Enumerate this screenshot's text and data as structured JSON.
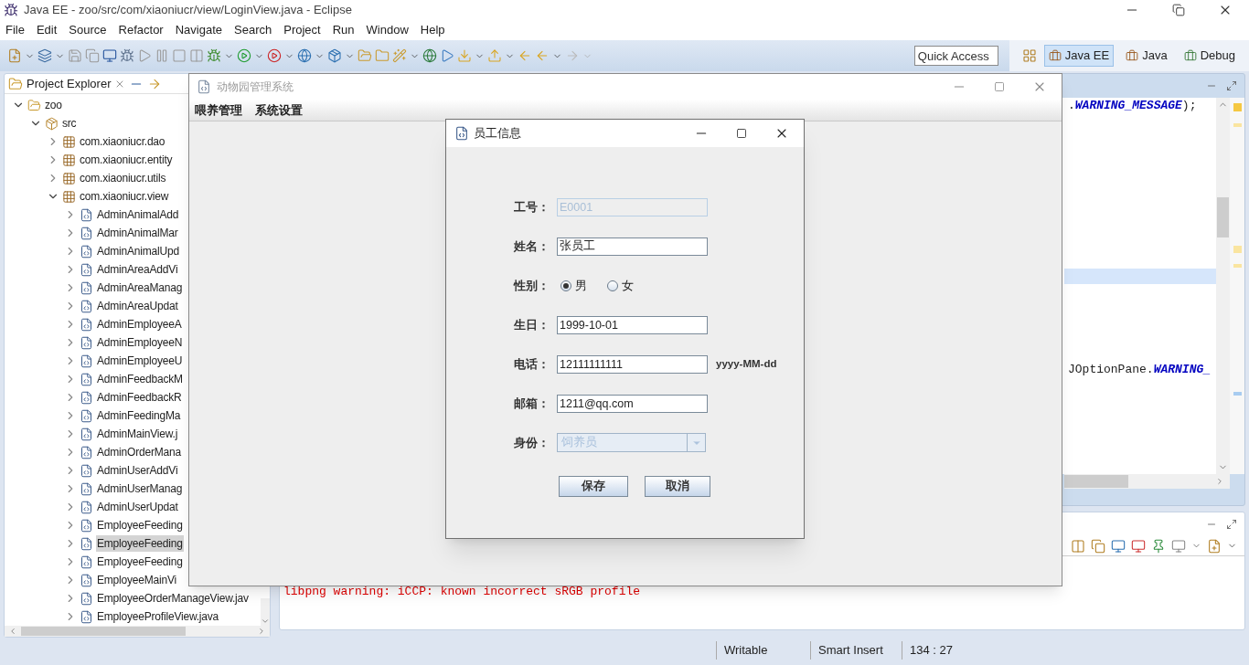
{
  "window": {
    "title": "Java EE - zoo/src/com/xiaoniucr/view/LoginView.java - Eclipse"
  },
  "menu": [
    "File",
    "Edit",
    "Source",
    "Refactor",
    "Navigate",
    "Search",
    "Project",
    "Run",
    "Window",
    "Help"
  ],
  "toolbar": {
    "quick_access": {
      "placeholder": "Quick Access"
    },
    "perspectives": [
      {
        "label": "Java EE",
        "selected": true
      },
      {
        "label": "Java",
        "selected": false
      },
      {
        "label": "Debug",
        "selected": false
      }
    ]
  },
  "project_explorer": {
    "title": "Project Explorer",
    "tree": [
      {
        "label": "zoo",
        "kind": "project",
        "expanded": true,
        "selected": false,
        "children": [
          {
            "label": "src",
            "kind": "folder",
            "expanded": true,
            "selected": false,
            "children": [
              {
                "label": "com.xiaoniucr.dao",
                "kind": "package",
                "expanded": false,
                "selected": false
              },
              {
                "label": "com.xiaoniucr.entity",
                "kind": "package",
                "expanded": false,
                "selected": false
              },
              {
                "label": "com.xiaoniucr.utils",
                "kind": "package",
                "expanded": false,
                "selected": false
              },
              {
                "label": "com.xiaoniucr.view",
                "kind": "package",
                "expanded": true,
                "selected": false,
                "children": [
                  {
                    "label": "AdminAnimalAdd",
                    "kind": "file",
                    "expanded": false,
                    "selected": false
                  },
                  {
                    "label": "AdminAnimalMar",
                    "kind": "file",
                    "expanded": false,
                    "selected": false
                  },
                  {
                    "label": "AdminAnimalUpd",
                    "kind": "file",
                    "expanded": false,
                    "selected": false
                  },
                  {
                    "label": "AdminAreaAddVi",
                    "kind": "file",
                    "expanded": false,
                    "selected": false
                  },
                  {
                    "label": "AdminAreaManag",
                    "kind": "file",
                    "expanded": false,
                    "selected": false
                  },
                  {
                    "label": "AdminAreaUpdat",
                    "kind": "file",
                    "expanded": false,
                    "selected": false
                  },
                  {
                    "label": "AdminEmployeeA",
                    "kind": "file",
                    "expanded": false,
                    "selected": false
                  },
                  {
                    "label": "AdminEmployeeN",
                    "kind": "file",
                    "expanded": false,
                    "selected": false
                  },
                  {
                    "label": "AdminEmployeeU",
                    "kind": "file",
                    "expanded": false,
                    "selected": false
                  },
                  {
                    "label": "AdminFeedbackM",
                    "kind": "file",
                    "expanded": false,
                    "selected": false
                  },
                  {
                    "label": "AdminFeedbackR",
                    "kind": "file",
                    "expanded": false,
                    "selected": false
                  },
                  {
                    "label": "AdminFeedingMa",
                    "kind": "file",
                    "expanded": false,
                    "selected": false
                  },
                  {
                    "label": "AdminMainView.j",
                    "kind": "file",
                    "expanded": false,
                    "selected": false
                  },
                  {
                    "label": "AdminOrderMana",
                    "kind": "file",
                    "expanded": false,
                    "selected": false
                  },
                  {
                    "label": "AdminUserAddVi",
                    "kind": "file",
                    "expanded": false,
                    "selected": false
                  },
                  {
                    "label": "AdminUserManag",
                    "kind": "file",
                    "expanded": false,
                    "selected": false
                  },
                  {
                    "label": "AdminUserUpdat",
                    "kind": "file",
                    "expanded": false,
                    "selected": false
                  },
                  {
                    "label": "EmployeeFeeding",
                    "kind": "file",
                    "expanded": false,
                    "selected": false
                  },
                  {
                    "label": "EmployeeFeeding",
                    "kind": "file",
                    "expanded": false,
                    "selected": true
                  },
                  {
                    "label": "EmployeeFeeding",
                    "kind": "file",
                    "expanded": false,
                    "selected": false
                  },
                  {
                    "label": "EmployeeMainVi",
                    "kind": "file",
                    "expanded": false,
                    "selected": false
                  },
                  {
                    "label": "EmployeeOrderManageView.jav",
                    "kind": "file",
                    "expanded": false,
                    "selected": false
                  },
                  {
                    "label": "EmployeeProfileView.java",
                    "kind": "file",
                    "expanded": false,
                    "selected": false
                  }
                ]
              }
            ]
          }
        ]
      }
    ]
  },
  "editor": {
    "lines": [
      {
        "kind": "code",
        "current": false,
        "segments": [
          {
            "text": ".",
            "kind": "plain"
          },
          {
            "text": "WARNING_MESSAGE",
            "kind": "constant"
          },
          {
            "text": ");",
            "kind": "plain"
          }
        ]
      },
      {
        "kind": "blank",
        "current": false
      },
      {
        "kind": "blank",
        "current": false
      },
      {
        "kind": "blank",
        "current": false
      },
      {
        "kind": "blank",
        "current": false
      },
      {
        "kind": "blank",
        "current": false
      },
      {
        "kind": "blank",
        "current": false
      },
      {
        "kind": "blank",
        "current": false
      },
      {
        "kind": "blank",
        "current": false
      },
      {
        "kind": "blank",
        "current": false
      },
      {
        "kind": "blank",
        "current": false
      },
      {
        "kind": "blank",
        "current": true
      },
      {
        "kind": "blank",
        "current": false
      },
      {
        "kind": "blank",
        "current": false
      },
      {
        "kind": "blank",
        "current": false
      },
      {
        "kind": "blank",
        "current": false
      },
      {
        "kind": "blank",
        "current": false
      },
      {
        "kind": "code",
        "current": false,
        "segments": [
          {
            "text": "JOptionPane.",
            "kind": "plain"
          },
          {
            "text": "WARNING_",
            "kind": "constant"
          }
        ]
      }
    ]
  },
  "console": {
    "lines": [
      "libpng warning: iCCP: known incorrect sRGB profile"
    ]
  },
  "status_bar": [
    "Writable",
    "Smart Insert",
    "134 : 27"
  ],
  "app_window": {
    "title": "动物园管理系统",
    "active": false,
    "menu": [
      "喂养管理",
      "系统设置"
    ]
  },
  "dialog": {
    "title": "员工信息",
    "fields": [
      {
        "kind": "text",
        "label": "工号：",
        "value": "E0001",
        "disabled": true
      },
      {
        "kind": "text",
        "label": "姓名：",
        "value": "张员工",
        "disabled": false
      },
      {
        "kind": "radio",
        "label": "性别：",
        "options": [
          {
            "label": "男",
            "selected": true
          },
          {
            "label": "女",
            "selected": false
          }
        ]
      },
      {
        "kind": "text",
        "label": "生日：",
        "value": "1999-10-01",
        "disabled": false
      },
      {
        "kind": "text",
        "label": "电话：",
        "value": "12111111111",
        "disabled": false,
        "hint": "yyyy-MM-dd"
      },
      {
        "kind": "text",
        "label": "邮箱：",
        "value": "1211@qq.com",
        "disabled": false
      },
      {
        "kind": "select",
        "label": "身份：",
        "value": "饲养员",
        "disabled": true
      }
    ],
    "buttons": [
      "保存",
      "取消"
    ]
  }
}
